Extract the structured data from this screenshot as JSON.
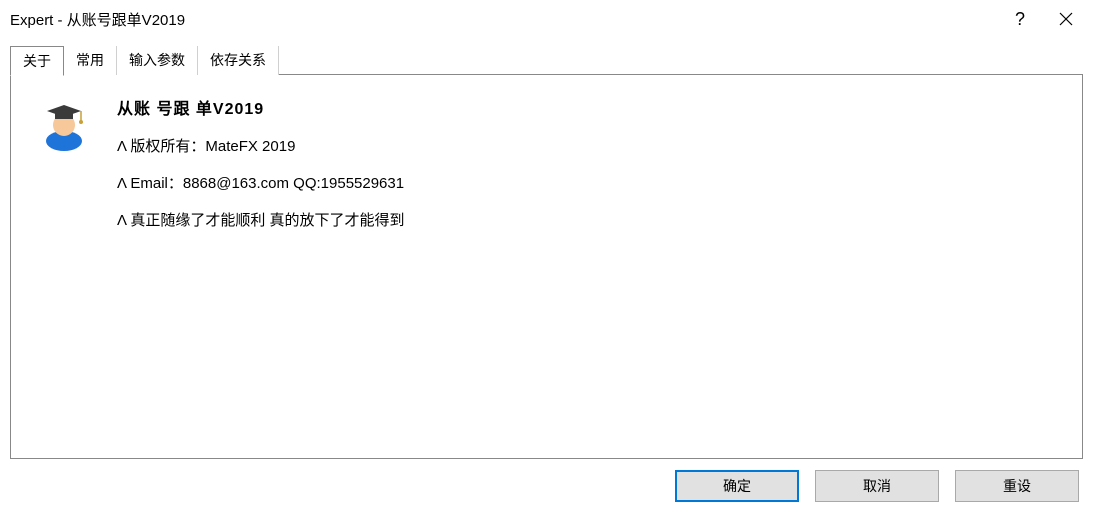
{
  "window": {
    "title": "Expert - 从账号跟单V2019"
  },
  "tabs": {
    "items": [
      {
        "label": "关于",
        "active": true
      },
      {
        "label": "常用",
        "active": false
      },
      {
        "label": "输入参数",
        "active": false
      },
      {
        "label": "依存关系",
        "active": false
      }
    ]
  },
  "about": {
    "title": "从账 号跟 单V2019",
    "line1": "Λ 版权所有：MateFX 2019",
    "line2": "Λ Email：8868@163.com  QQ:1955529631",
    "line3": "Λ 真正随缘了才能顺利 真的放下了才能得到"
  },
  "buttons": {
    "ok": "确定",
    "cancel": "取消",
    "reset": "重设"
  },
  "icons": {
    "help": "?",
    "close": "close-icon",
    "expert": "expert-avatar-icon"
  }
}
